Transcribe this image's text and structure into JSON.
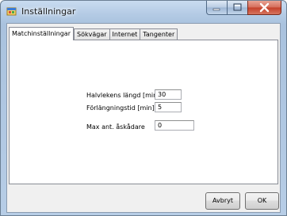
{
  "window": {
    "title": "Inställningar",
    "icon": "settings-app-icon",
    "caption_icons": [
      "minimize-icon",
      "maximize-icon",
      "close-icon"
    ]
  },
  "tabs": [
    {
      "label": "Matchinställningar",
      "active": true
    },
    {
      "label": "Sökvägar",
      "active": false
    },
    {
      "label": "Internet",
      "active": false
    },
    {
      "label": "Tangenter",
      "active": false
    }
  ],
  "settings": {
    "half_length": {
      "label": "Halvlekens längd [min]",
      "value": "30"
    },
    "overtime": {
      "label": "Förlängningstid [min]",
      "value": "5"
    },
    "max_spectators": {
      "label": "Max ant. åskådare",
      "value": "0"
    }
  },
  "buttons": {
    "cancel": "Avbryt",
    "ok": "OK"
  },
  "colors": {
    "titlebar": "#b3cae4",
    "close_button": "#c4402a",
    "dialog_face": "#f0f0f0"
  }
}
